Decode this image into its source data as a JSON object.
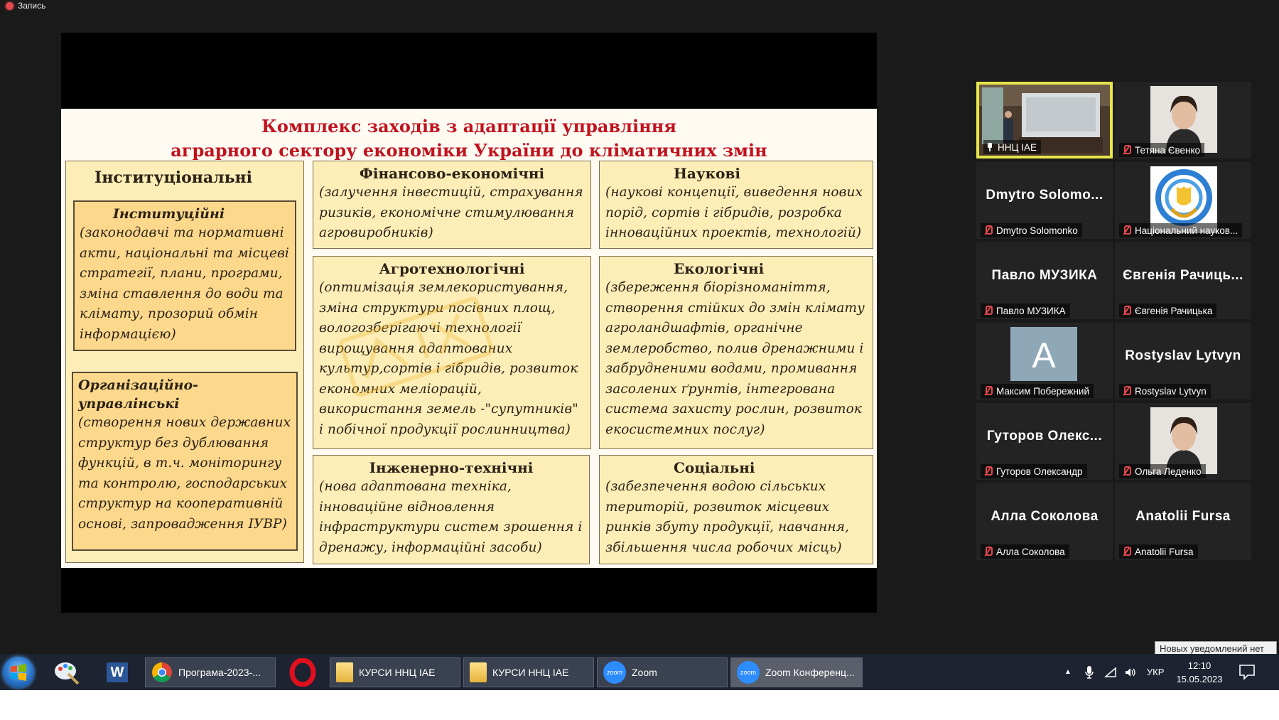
{
  "recording": {
    "label": "Запись"
  },
  "slide": {
    "title_line1": "Комплекс заходів з адаптації управління",
    "title_line2": "аграрного сектору економіки України до кліматичних змін",
    "institutional": {
      "heading": "Інституціональні",
      "institutional_box": {
        "heading": "Інституційні",
        "text": "(законодавчі та нормативні акти, національні та місцеві стратегії, плани, програми, зміна ставлення до води та клімату, прозорий обмін інформацією)"
      },
      "organizational_box": {
        "heading": "Організаційно-управлінські",
        "text": "(створення нових державних структур без дублювання функцій, в т.ч. моніторингу та контролю, господарських структур на кооперативній основі, запровадження ІУВР)"
      }
    },
    "financial": {
      "heading": "Фінансово-економічні",
      "text": "(залучення інвестицій, страхування ризиків, економічне стимулювання агровиробників)"
    },
    "scientific": {
      "heading": "Наукові",
      "text": "(наукові концепції, виведення нових порід, сортів і гібридів, розробка інноваційних проектів, технологій)"
    },
    "agrotech": {
      "heading": "Агротехнологічні",
      "text": "(оптимізація землекористування, зміна структури посівних площ, вологозберігаючі технології вирощування адаптованих культур,сортів і гібридів, розвиток економних меліорацій, використання земель -\"супутників\" і побічної продукції рослинництва)"
    },
    "ecological": {
      "heading": "Екологічні",
      "text": "(збереження біорізноманіття, створення стійких до змін клімату агроландшафтів, органічне землеробство, полив дренажними і забрудненими водами, промивання засолених ґрунтів, інтегрована система захисту рослин, розвиток екосистемних послуг)"
    },
    "engineering": {
      "heading": "Інженерно-технічні",
      "text": "(нова адаптована техніка, інноваційне відновлення інфраструктури систем зрошення і дренажу, інформаційні засоби)"
    },
    "social": {
      "heading": "Соціальні",
      "text": "(забезпечення водою сільських територій, розвиток місцевих ринків збуту продукції, навчання, збільшення числа робочих місць)"
    }
  },
  "participants": [
    {
      "display": "",
      "label": "ННЦ ІАЕ",
      "kind": "video",
      "active": true
    },
    {
      "display": "",
      "label": "Тетяна Євенко",
      "kind": "photo"
    },
    {
      "display": "Dmytro Solomo...",
      "label": "Dmytro Solomonko",
      "kind": "name"
    },
    {
      "display": "",
      "label": "Національний науков...",
      "kind": "logo"
    },
    {
      "display": "Павло МУЗИКА",
      "label": "Павло МУЗИКА",
      "kind": "name"
    },
    {
      "display": "Євгенія Рачиць...",
      "label": "Євгенія Рачицька",
      "kind": "name"
    },
    {
      "display": "A",
      "label": "Максим Побережний",
      "kind": "letter"
    },
    {
      "display": "Rostyslav Lytvyn",
      "label": "Rostyslav Lytvyn",
      "kind": "name"
    },
    {
      "display": "Гуторов Олекс...",
      "label": "Гуторов Олександр",
      "kind": "name"
    },
    {
      "display": "",
      "label": "Ольга Леденко",
      "kind": "photo"
    },
    {
      "display": "Алла Соколова",
      "label": "Алла Соколова",
      "kind": "name"
    },
    {
      "display": "Anatolii Fursa",
      "label": "Anatolii Fursa",
      "kind": "name"
    }
  ],
  "notification": "Новых уведомлений нет",
  "taskbar": {
    "chrome_label": "Програма-2023-...",
    "folder1_label": "КУРСИ ННЦ ІАЕ",
    "folder2_label": "КУРСИ ННЦ ІАЕ",
    "zoom_label": "Zoom",
    "zoom_conf_label": "Zoom Конференц...",
    "zoom_logo_text": "zoom",
    "word_letter": "W",
    "lang": "УКР",
    "time": "12:10",
    "date": "15.05.2023"
  }
}
